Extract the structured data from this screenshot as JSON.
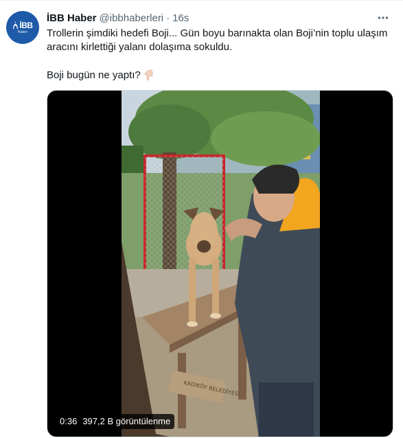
{
  "tweet": {
    "display_name": "İBB Haber",
    "handle": "@ibbhaberleri",
    "separator": "·",
    "timestamp": "16s",
    "text_line1": "Trollerin şimdiki hedefi Boji... Gün boyu barınakta olan Boji’nin toplu ulaşım aracını kirlettiği yalanı dolaşıma sokuldu.",
    "text_line2": "Boji bugün ne yaptı?"
  },
  "avatar": {
    "brand": "İBB",
    "subtitle": "Haber"
  },
  "media": {
    "duration": "0:36",
    "views": "397,2 B görüntülenme",
    "sign_text": "KADIKÖY BELEDİYESİ"
  },
  "colors": {
    "avatar_bg": "#1e5aa8",
    "secondary_text": "#536471",
    "primary_text": "#0f1419"
  },
  "icons": [
    "more-options-icon",
    "pointing-down-emoji-icon",
    "istanbul-logo-icon"
  ]
}
